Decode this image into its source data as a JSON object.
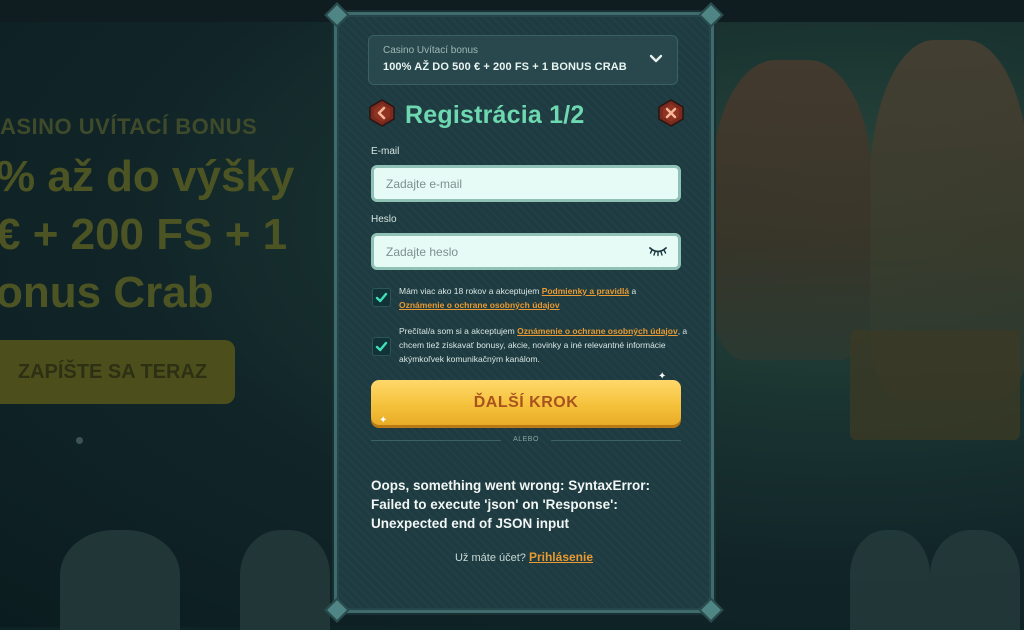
{
  "background": {
    "kicker": "ASINO UVÍTACÍ BONUS",
    "headline_lines": [
      "% až do výšky",
      "€ + 200 FS + 1",
      "onus Crab"
    ],
    "cta_label": "ZAPÍŠTE SA TERAZ"
  },
  "modal": {
    "bonus_select": {
      "label": "Casino Uvítací bonus",
      "value": "100% AŽ DO 500 € + 200 FS + 1 BONUS CRAB"
    },
    "title": "Registrácia 1/2",
    "email": {
      "label": "E-mail",
      "placeholder": "Zadajte e-mail"
    },
    "password": {
      "label": "Heslo",
      "placeholder": "Zadajte heslo"
    },
    "consent_terms": {
      "checked": true,
      "text_before": "Mám viac ako 18 rokov a akceptujem ",
      "link1": "Podmienky a pravidlá",
      "text_mid": " a ",
      "link2": "Oznámenie o ochrane osobných údajov"
    },
    "consent_marketing": {
      "checked": true,
      "text_before": "Prečítal/a som si a akceptujem ",
      "link": "Oznámenie o ochrane osobných údajov",
      "text_after": ", a chcem tiež získavať bonusy, akcie, novinky a iné relevantné informácie akýmkoľvek komunikačným kanálom."
    },
    "next_button": "ĎALŠÍ KROK",
    "or_label": "ALEBO",
    "error_message": "Oops, something went wrong: SyntaxError: Failed to execute 'json' on 'Response': Unexpected end of JSON input",
    "login_prompt": "Už máte účet?",
    "login_link": "Prihlásenie"
  },
  "colors": {
    "accent_title": "#6ed8b0",
    "button_yellow": "#f5c23c",
    "link_orange": "#e99a33",
    "modal_bg": "#1d3b40"
  },
  "icons": [
    "chevron-down-icon",
    "back-arrow-icon",
    "close-icon",
    "eye-closed-icon",
    "checkmark-icon"
  ]
}
